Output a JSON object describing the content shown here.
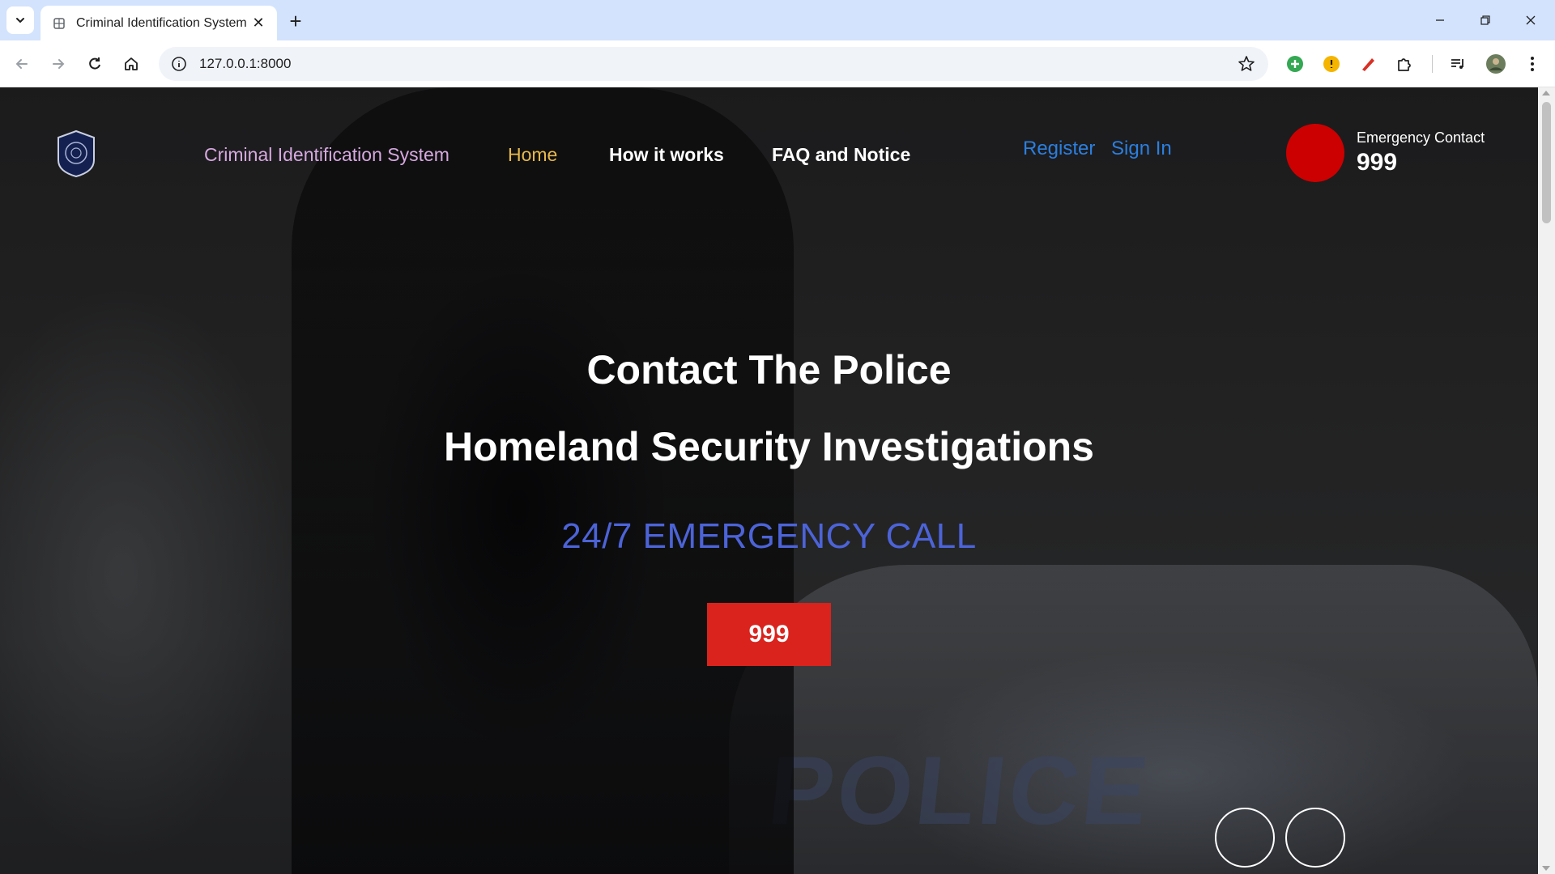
{
  "browser": {
    "tab_title": "Criminal Identification System",
    "tab_close": "✕",
    "new_tab": "+",
    "url": "127.0.0.1:8000",
    "icons": {
      "tab_dropdown": "chevron-down-icon",
      "favicon": "globe-icon",
      "back": "back-arrow-icon",
      "forward": "forward-arrow-icon",
      "reload": "reload-icon",
      "home": "home-icon",
      "site_info": "info-icon",
      "bookmark": "star-icon",
      "extensions": [
        "green-plus-extension-icon",
        "yellow-extension-icon",
        "red-pen-extension-icon",
        "puzzle-icon",
        "media-control-icon",
        "profile-avatar-icon",
        "menu-dots-icon"
      ]
    }
  },
  "site": {
    "brand": "Criminal Identification System",
    "nav": {
      "home": "Home",
      "how": "How it works",
      "faq": "FAQ and Notice"
    },
    "auth": {
      "register": "Register",
      "signin": "Sign In"
    },
    "emergency": {
      "label": "Emergency Contact",
      "number": "999"
    },
    "hero": {
      "title_1": "Contact The Police",
      "title_2": "Homeland Security Investigations",
      "subtitle": "24/7 EMERGENCY CALL",
      "button": "999",
      "background_text": "POLICE"
    }
  },
  "colors": {
    "brand": "#d7a8e0",
    "home_active": "#e6b84a",
    "auth_link": "#2b7fe0",
    "subtitle": "#4c63d8",
    "emergency_red": "#cc0000",
    "button_red": "#d9231c"
  }
}
